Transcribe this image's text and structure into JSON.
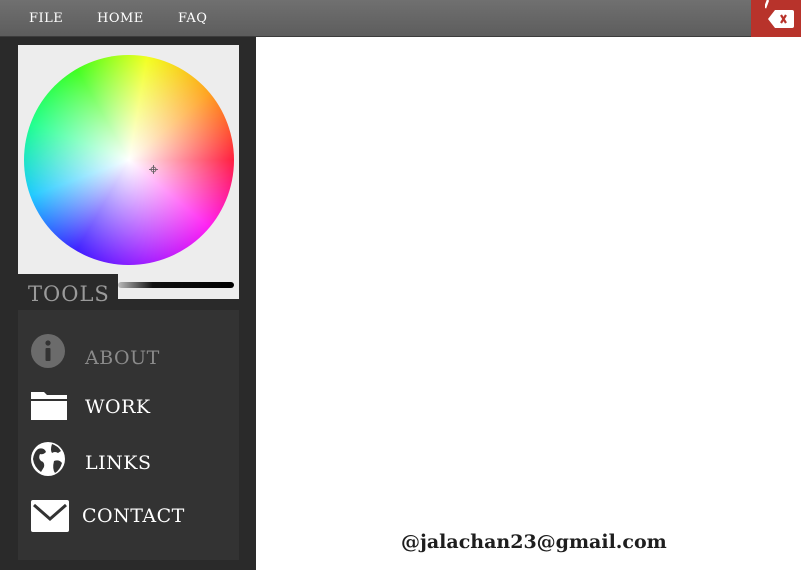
{
  "menu": {
    "file": "FILE",
    "home": "HOME",
    "faq": "FAQ"
  },
  "colors": {
    "menu_bar": "#666666",
    "close": "#b8332b",
    "sidebar": "#2a2a2a",
    "panel": "#333333"
  },
  "sidebar": {
    "tools_label": "TOOLS",
    "items": [
      {
        "label": "ABOUT",
        "icon": "info-icon",
        "state": "disabled"
      },
      {
        "label": "WORK",
        "icon": "folder-icon"
      },
      {
        "label": "LINKS",
        "icon": "globe-icon"
      },
      {
        "label": "CONTACT",
        "icon": "mail-icon"
      }
    ]
  },
  "footer": {
    "email": "@jalachan23@gmail.com"
  }
}
